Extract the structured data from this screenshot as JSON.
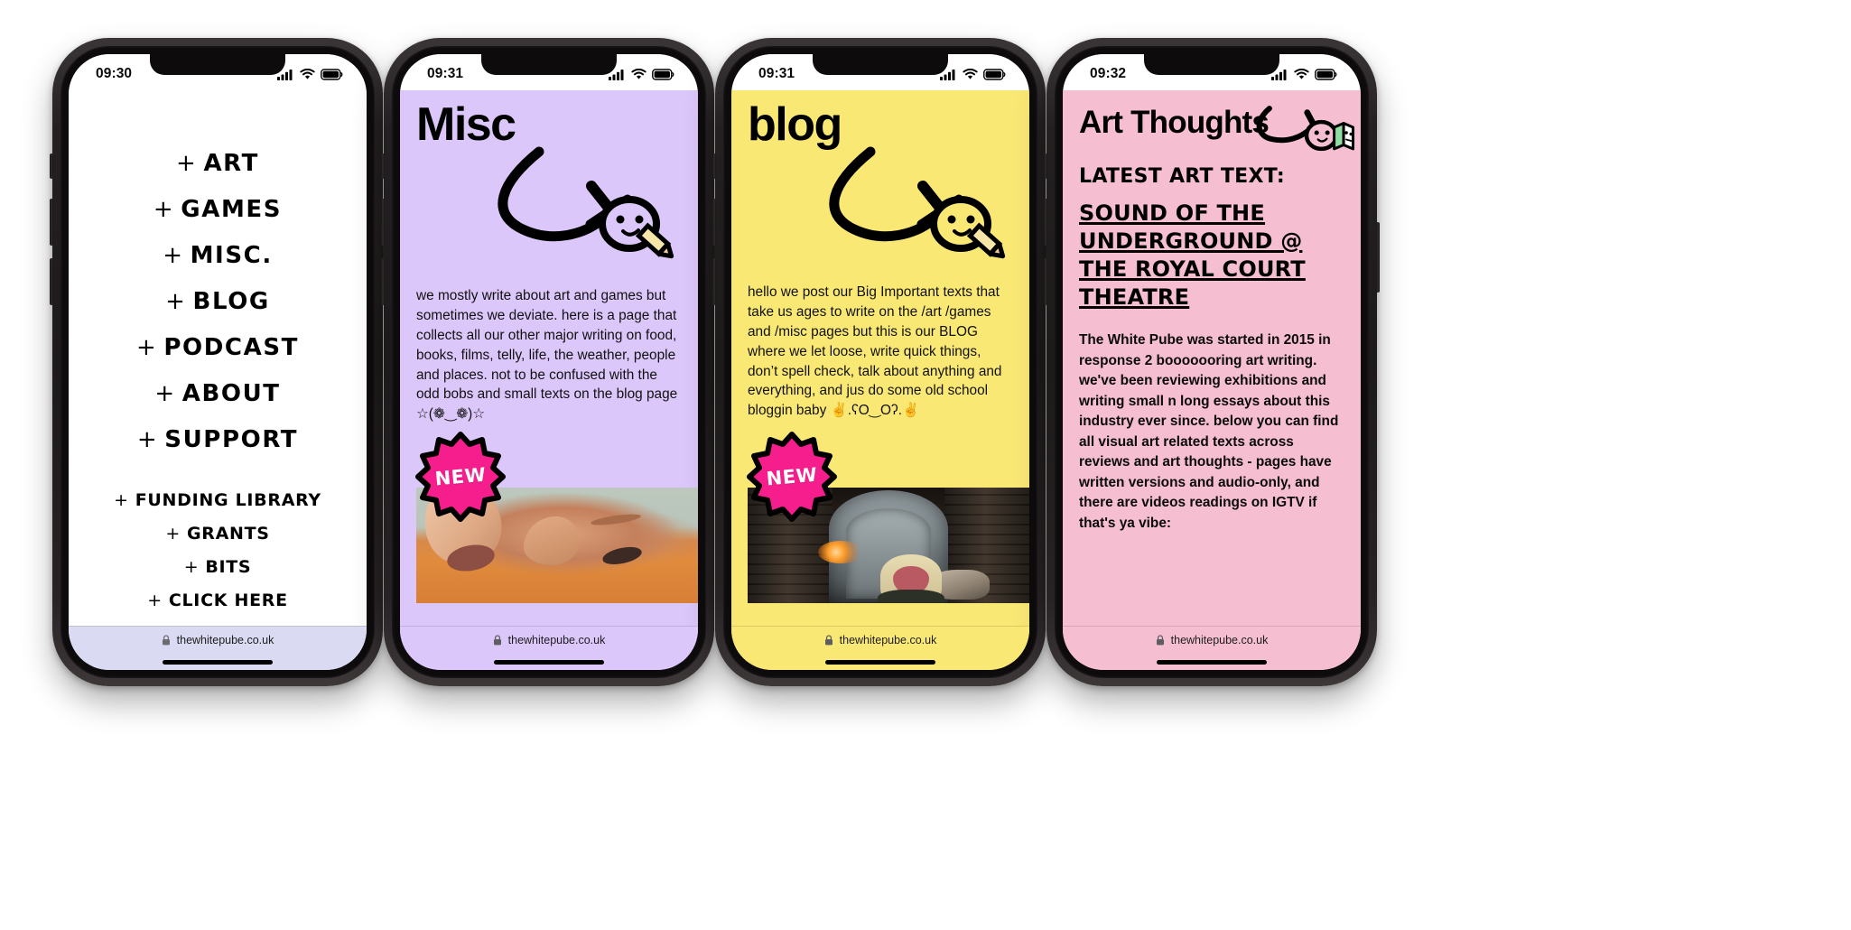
{
  "colors": {
    "phone1_bg": "#ffffff",
    "phone1_urlbar": "#dadaf2",
    "phone2_bg": "#dcc7fa",
    "phone3_bg": "#fae875",
    "phone4_bg": "#f5bed1",
    "badge_pink": "#f51e8c",
    "badge_outline": "#000000",
    "badge_text": "#ffffff",
    "book_green": "#8fe0a0"
  },
  "site_url": "thewhitepube.co.uk",
  "phones": [
    {
      "id": "phone-menu",
      "clock": "09:30",
      "menu": {
        "primary": [
          {
            "plus": "+",
            "label": "ART"
          },
          {
            "plus": "+",
            "label": "GAMES"
          },
          {
            "plus": "+",
            "label": "MISC."
          },
          {
            "plus": "+",
            "label": "BLOG"
          },
          {
            "plus": "+",
            "label": "PODCAST"
          },
          {
            "plus": "+",
            "label": "ABOUT"
          },
          {
            "plus": "+",
            "label": "SUPPORT"
          }
        ],
        "secondary": [
          {
            "plus": "+",
            "label": "FUNDING LIBRARY"
          },
          {
            "plus": "+",
            "label": "GRANTS"
          },
          {
            "plus": "+",
            "label": "BITS"
          },
          {
            "plus": "+",
            "label": "CLICK HERE"
          }
        ]
      }
    },
    {
      "id": "phone-misc",
      "clock": "09:31",
      "title": "Misc",
      "body": "we mostly write about art and games but sometimes we deviate. here is a page that collects all our other major writing on food, books, films, telly, life, the weather, people and places. not to be confused with the odd bobs and small texts on the blog page ☆(❁‿❁)☆",
      "badge": "NEW"
    },
    {
      "id": "phone-blog",
      "clock": "09:31",
      "title": "blog",
      "body": "hello we post our Big Important texts that take us ages to write on the /art /games and /misc pages but this is our BLOG where we let loose, write quick things, don’t spell check, talk about anything and everything, and jus do some old school bloggin baby ✌.ʕO‿Oʔ.✌",
      "badge": "NEW"
    },
    {
      "id": "phone-art-thoughts",
      "clock": "09:32",
      "title": "Art Thoughts",
      "latest_label": "LATEST ART TEXT:",
      "latest_link": "SOUND OF THE UNDERGROUND @ THE ROYAL COURT THEATRE",
      "body": "The White Pube was started in 2015 in response 2 booooooring art writing. we've been reviewing exhibitions and writing small n long essays about this industry ever since. below you can find all visual art related texts across reviews and art thoughts - pages have written versions and audio-only, and there are videos readings on IGTV if that's ya vibe:"
    }
  ]
}
